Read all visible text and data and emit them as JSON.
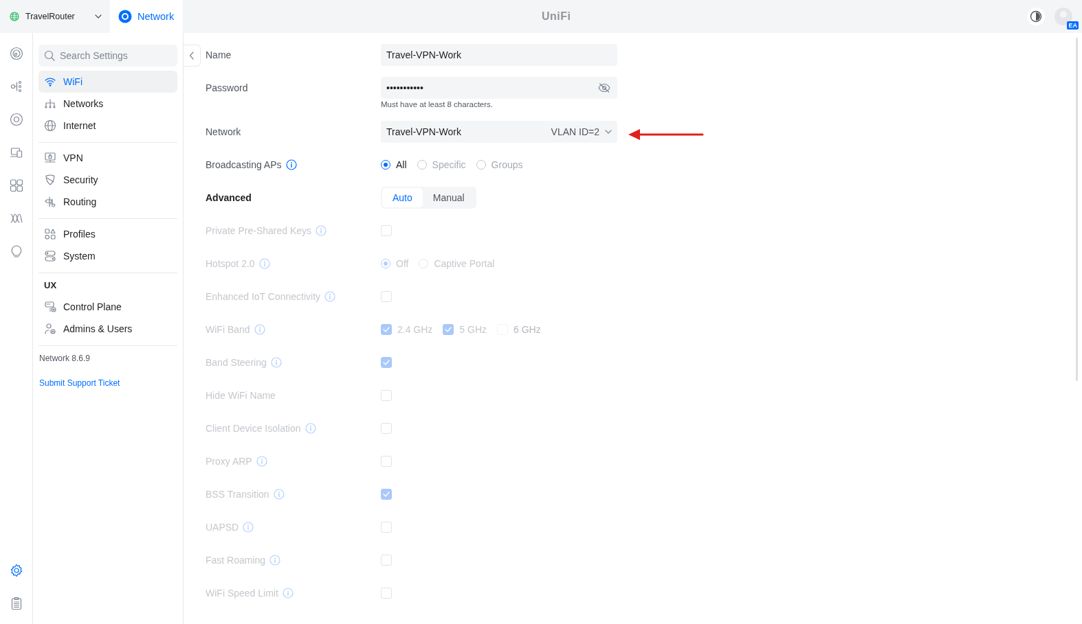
{
  "top_bar": {
    "site": {
      "name": "TravelRouter"
    },
    "app_tab": {
      "label": "Network",
      "selected": true
    },
    "brand": "UniFi",
    "avatar_badge": "EA"
  },
  "rail": {
    "items": [
      {
        "selected": false
      },
      {
        "selected": false
      },
      {
        "selected": false
      },
      {
        "selected": false
      },
      {
        "selected": false
      },
      {
        "selected": false
      },
      {
        "selected": false
      }
    ],
    "bottom_items": [
      {
        "selected": true
      },
      {
        "selected": false
      }
    ]
  },
  "sidebar": {
    "search": {
      "placeholder": "Search Settings"
    },
    "groups": [
      {
        "items": [
          {
            "label": "WiFi",
            "selected": true
          },
          {
            "label": "Networks",
            "selected": false
          },
          {
            "label": "Internet",
            "selected": false
          }
        ]
      },
      {
        "items": [
          {
            "label": "VPN",
            "selected": false
          },
          {
            "label": "Security",
            "selected": false
          },
          {
            "label": "Routing",
            "selected": false
          }
        ]
      },
      {
        "items": [
          {
            "label": "Profiles",
            "selected": false
          },
          {
            "label": "System",
            "selected": false
          }
        ]
      },
      {
        "heading": "UX",
        "items": [
          {
            "label": "Control Plane",
            "selected": false
          },
          {
            "label": "Admins & Users",
            "selected": false
          }
        ]
      }
    ],
    "version": "Network 8.6.9",
    "support_link": "Submit Support Ticket"
  },
  "form": {
    "rows": [
      {
        "kind": "text_field",
        "label": "Name",
        "value": "Travel-VPN-Work"
      },
      {
        "kind": "password_field",
        "label": "Password",
        "value": "•••••••••••",
        "hint": "Must have at least 8 characters."
      },
      {
        "kind": "select",
        "label": "Network",
        "value": "Travel-VPN-Work",
        "detail": "VLAN ID=2"
      },
      {
        "kind": "radio",
        "label": "Broadcasting APs",
        "info": true,
        "disabled": false,
        "options": [
          {
            "label": "All",
            "selected": true
          },
          {
            "label": "Specific",
            "selected": false
          },
          {
            "label": "Groups",
            "selected": false
          }
        ]
      },
      {
        "kind": "segmented",
        "label": "Advanced",
        "options": [
          {
            "label": "Auto",
            "selected": true
          },
          {
            "label": "Manual",
            "selected": false
          }
        ]
      },
      {
        "kind": "checkbox",
        "label": "Private Pre-Shared Keys",
        "info": true,
        "disabled": true,
        "checked": false
      },
      {
        "kind": "radio",
        "label": "Hotspot 2.0",
        "info": true,
        "disabled": true,
        "options": [
          {
            "label": "Off",
            "selected": true
          },
          {
            "label": "Captive Portal",
            "selected": false
          }
        ]
      },
      {
        "kind": "checkbox",
        "label": "Enhanced IoT Connectivity",
        "info": true,
        "disabled": true,
        "checked": false
      },
      {
        "kind": "checkboxes",
        "label": "WiFi Band",
        "info": true,
        "disabled": true,
        "options": [
          {
            "label": "2.4 GHz",
            "checked": true,
            "disabled": false
          },
          {
            "label": "5 GHz",
            "checked": true,
            "disabled": false
          },
          {
            "label": "6 GHz",
            "checked": false,
            "disabled": true
          }
        ]
      },
      {
        "kind": "checkbox",
        "label": "Band Steering",
        "info": true,
        "disabled": true,
        "checked": true
      },
      {
        "kind": "checkbox",
        "label": "Hide WiFi Name",
        "info": false,
        "disabled": true,
        "checked": false
      },
      {
        "kind": "checkbox",
        "label": "Client Device Isolation",
        "info": true,
        "disabled": true,
        "checked": false
      },
      {
        "kind": "checkbox",
        "label": "Proxy ARP",
        "info": true,
        "disabled": true,
        "checked": false
      },
      {
        "kind": "checkbox",
        "label": "BSS Transition",
        "info": true,
        "disabled": true,
        "checked": true
      },
      {
        "kind": "checkbox",
        "label": "UAPSD",
        "info": true,
        "disabled": true,
        "checked": false
      },
      {
        "kind": "checkbox",
        "label": "Fast Roaming",
        "info": true,
        "disabled": true,
        "checked": false
      },
      {
        "kind": "checkbox",
        "label": "WiFi Speed Limit",
        "info": true,
        "disabled": true,
        "checked": false
      }
    ]
  }
}
